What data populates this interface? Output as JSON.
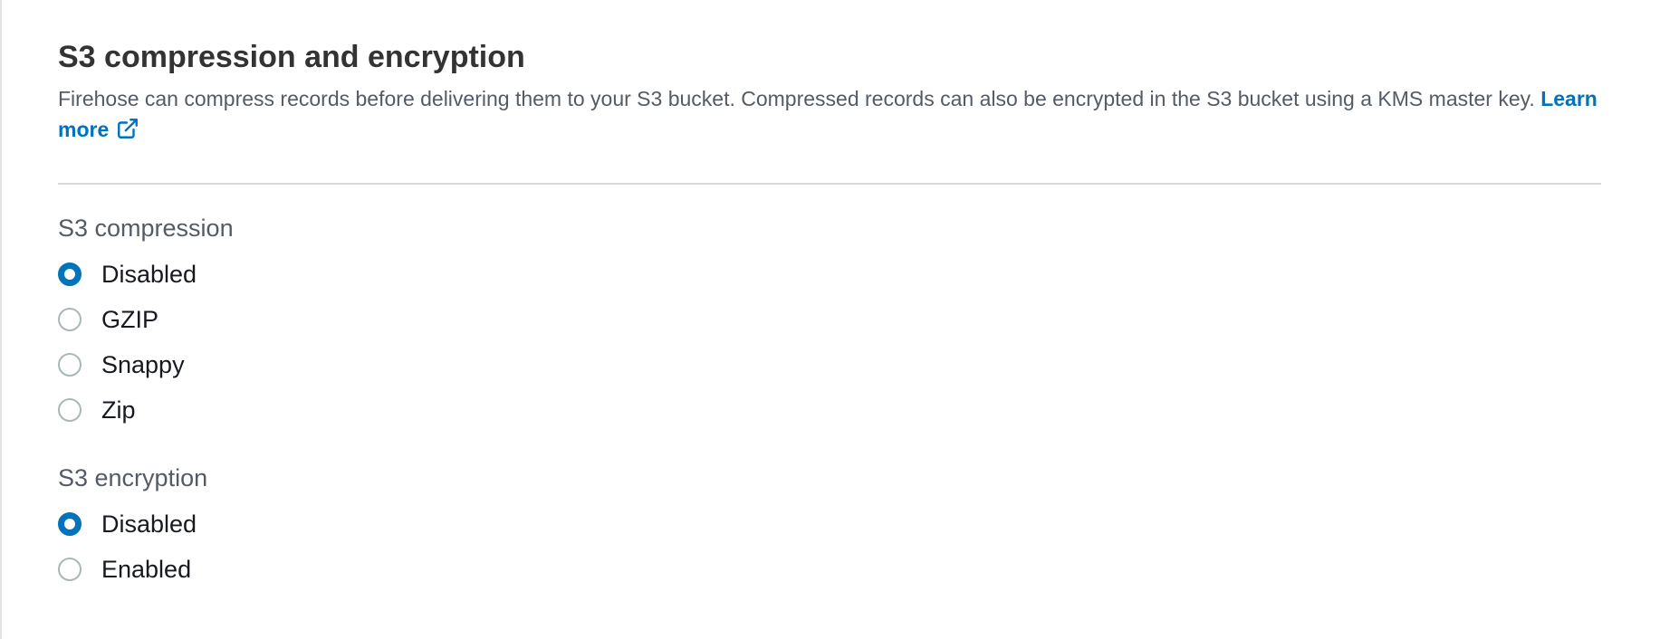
{
  "section": {
    "title": "S3 compression and encryption",
    "description": "Firehose can compress records before delivering them to your S3 bucket. Compressed records can also be encrypted in the S3 bucket using a KMS master key.",
    "learn_more": "Learn more"
  },
  "compression": {
    "label": "S3 compression",
    "options": [
      "Disabled",
      "GZIP",
      "Snappy",
      "Zip"
    ],
    "selected": "Disabled"
  },
  "encryption": {
    "label": "S3 encryption",
    "options": [
      "Disabled",
      "Enabled"
    ],
    "selected": "Disabled"
  },
  "colors": {
    "accent": "#0073bb",
    "title": "#333333",
    "text": "#545b64",
    "radio_border": "#aab7b8"
  },
  "icons": {
    "learn_more": "external-link-icon"
  }
}
